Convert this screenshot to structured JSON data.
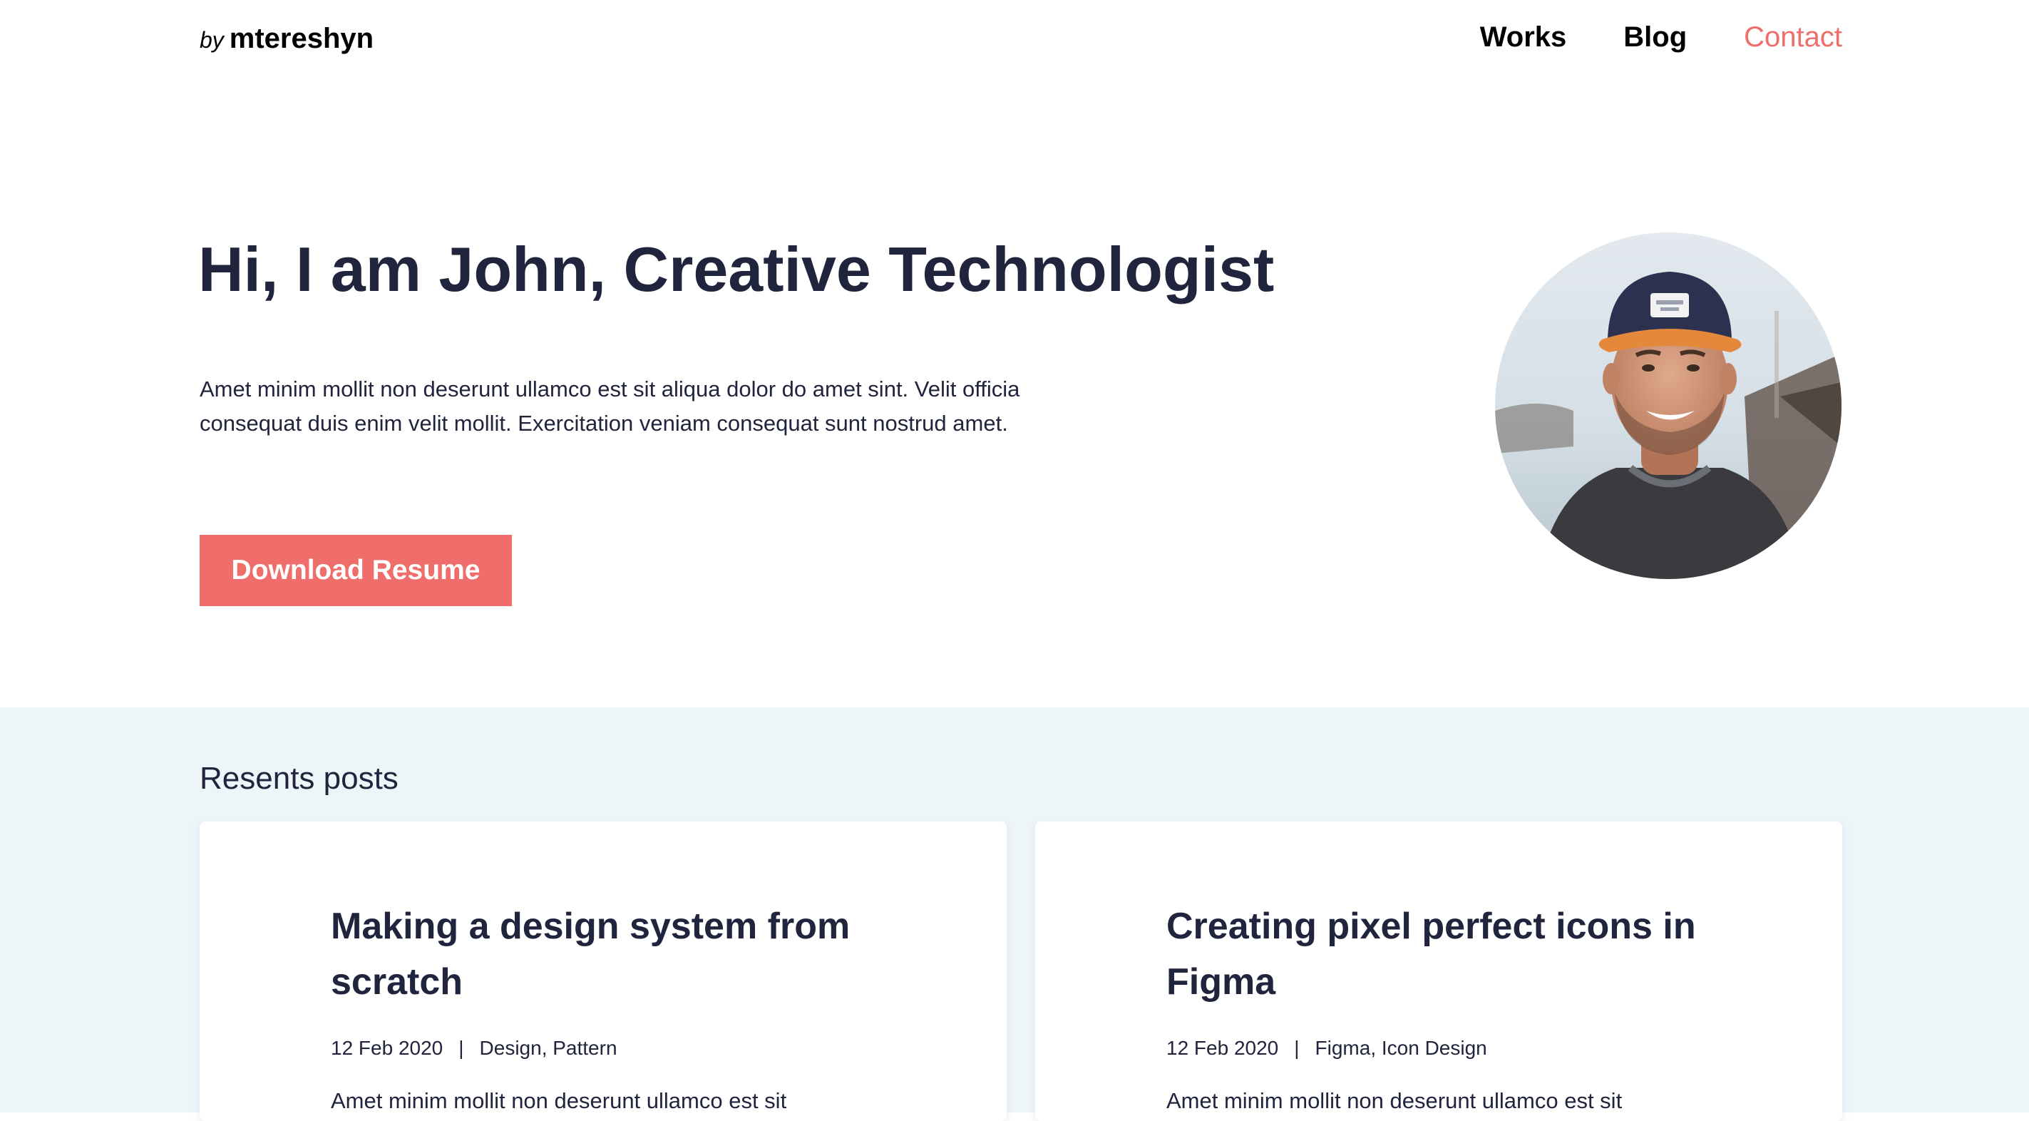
{
  "header": {
    "logo_by": "by",
    "logo_name": "mtereshyn",
    "nav": {
      "works": "Works",
      "blog": "Blog",
      "contact": "Contact"
    }
  },
  "hero": {
    "title": "Hi, I am John, Creative Technologist",
    "text": "Amet minim mollit non deserunt ullamco est sit aliqua dolor do amet sint. Velit officia consequat duis enim velit mollit. Exercitation veniam consequat sunt nostrud amet.",
    "button_label": "Download Resume"
  },
  "recent": {
    "title": "Resents posts",
    "posts": [
      {
        "title": "Making a design system from scratch",
        "date": "12 Feb 2020",
        "separator": "|",
        "tags": "Design, Pattern",
        "excerpt": "Amet minim mollit non deserunt ullamco est sit"
      },
      {
        "title": "Creating pixel perfect icons in Figma",
        "date": "12 Feb 2020",
        "separator": "|",
        "tags": "Figma, Icon Design",
        "excerpt": "Amet minim mollit non deserunt ullamco est sit"
      }
    ]
  },
  "colors": {
    "accent": "#ef6d6b",
    "text_dark": "#21243d",
    "section_bg": "#edf5f8",
    "card_bg": "#ffffff"
  }
}
